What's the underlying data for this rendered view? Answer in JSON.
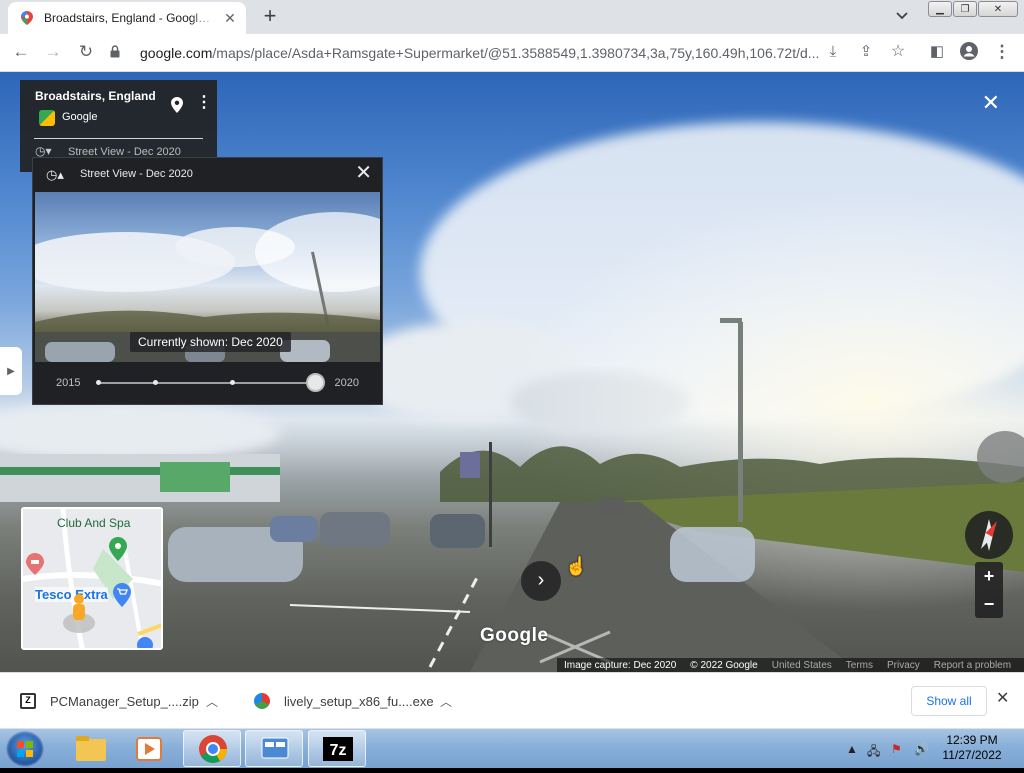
{
  "browser": {
    "tab_title": "Broadstairs, England - Google Maps",
    "tab_close": "✕",
    "new_tab": "+",
    "url_host": "google.com",
    "url_path": "/maps/place/Asda+Ramsgate+Supermarket/@51.3588549,1.3980734,3a,75y,160.49h,106.72t/d..."
  },
  "info_card": {
    "place_name": "Broadstairs, England",
    "provider": "Google",
    "imagery_label": "Street View - Dec 2020"
  },
  "time_machine": {
    "title": "Street View - Dec 2020",
    "currently_shown": "Currently shown: Dec 2020",
    "start_year": "2015",
    "end_year": "2020",
    "slider_position_fraction": 1.0
  },
  "minimap": {
    "poi_1": "Club And Spa",
    "poi_2": "Tesco Extra"
  },
  "zoom": {
    "in": "+",
    "out": "−"
  },
  "watermark": "Google",
  "footer": {
    "capture": "Image capture: Dec 2020",
    "copyright": "© 2022 Google",
    "country": "United States",
    "terms": "Terms",
    "privacy": "Privacy",
    "report": "Report a problem"
  },
  "downloads": {
    "items": [
      {
        "name": "PCManager_Setup_....zip"
      },
      {
        "name": "lively_setup_x86_fu....exe"
      }
    ],
    "show_all": "Show all"
  },
  "taskbar": {
    "time": "12:39 PM",
    "date": "11/27/2022"
  },
  "colors": {
    "link_blue": "#1a73e8",
    "panel_dark": "#202124"
  }
}
